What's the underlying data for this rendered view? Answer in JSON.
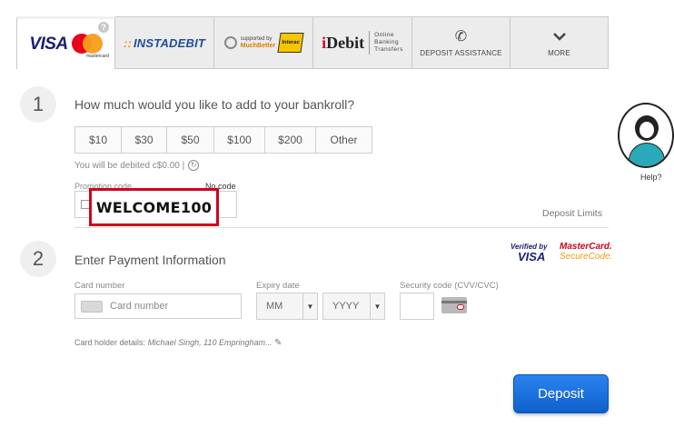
{
  "tabs": {
    "visa": {
      "brand": "VISA",
      "sub": "mastercard",
      "badge": "?"
    },
    "instadebit": {
      "label": "INSTADEBIT",
      "dots": "::"
    },
    "muchbetter": {
      "small": "supported by",
      "brand": "MuchBetter",
      "interac": "Interac"
    },
    "idebit": {
      "logo_i": "i",
      "logo_rest": "Debit",
      "sub1": "Online",
      "sub2": "Banking",
      "sub3": "Transfers"
    },
    "assistance": {
      "label": "DEPOSIT ASSISTANCE",
      "icon": "phone-icon"
    },
    "more": {
      "label": "MORE",
      "icon": "chevron-down-icon"
    }
  },
  "step1": {
    "number": "1",
    "question": "How much would you like to add to your bankroll?",
    "amounts": [
      "$10",
      "$30",
      "$50",
      "$100",
      "$200",
      "Other"
    ],
    "debited_text": "You will be debited c$0.00 |",
    "promo_label": "Promotion code",
    "no_code_label": "No code",
    "promo_value": "WELCOME100",
    "deposit_limits": "Deposit Limits"
  },
  "step2": {
    "number": "2",
    "title": "Enter Payment Information",
    "verified_by": "Verified by",
    "visa": "VISA",
    "mastercard": "MasterCard.",
    "securecode": "SecureCode.",
    "card_number_label": "Card number",
    "card_number_placeholder": "Card number",
    "expiry_label": "Expiry date",
    "month_value": "MM",
    "year_value": "YYYY",
    "security_label": "Security code (CVV/CVC)",
    "holder_label": "Card holder details:",
    "holder_value": "Michael Singh, 110 Empringham..."
  },
  "deposit_button": "Deposit",
  "help_label": "Help?",
  "colors": {
    "accent": "#1466d6",
    "highlight": "#d0021b"
  }
}
